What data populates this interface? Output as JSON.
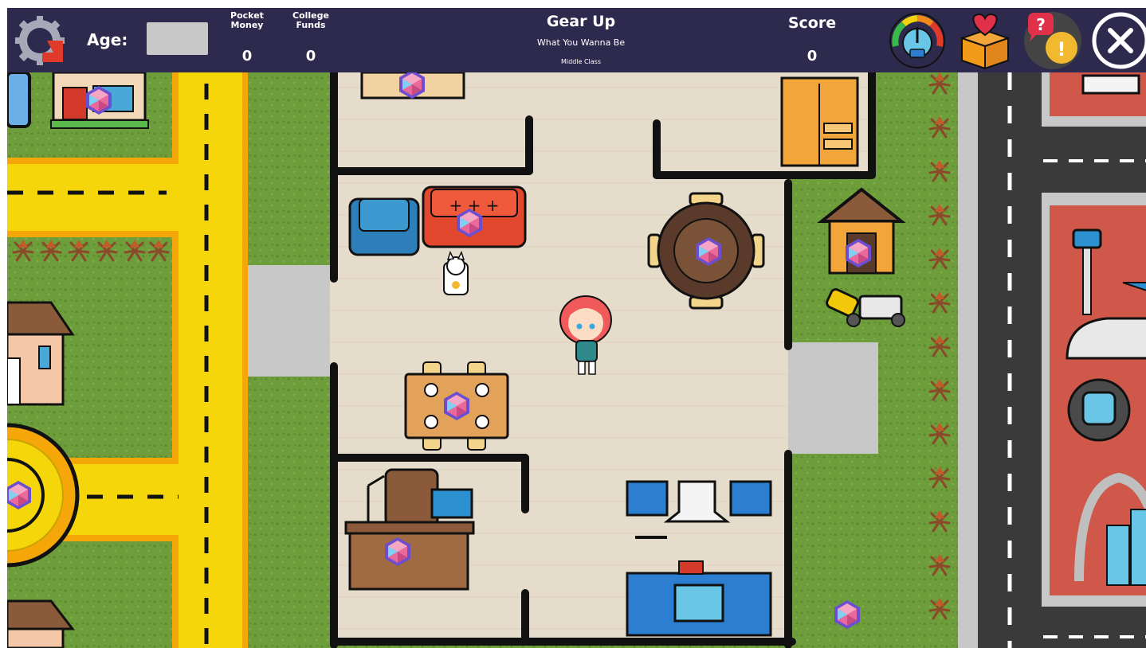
{
  "hud": {
    "age_label": "Age:",
    "age_value": "",
    "pocket_money_label": "Pocket Money",
    "pocket_money_value": "0",
    "college_funds_label": "College Funds",
    "college_funds_value": "0",
    "title": "Gear Up",
    "subtitle": "What You Wanna Be",
    "social_class": "Middle Class",
    "score_label": "Score",
    "score_value": "0"
  },
  "icons": {
    "logo": "gear-logo-icon",
    "meter": "speedometer-icon",
    "gift": "heart-gift-box-icon",
    "help": "question-exclamation-icon",
    "close": "close-icon"
  },
  "colors": {
    "hud_bg": "#2e2a4e",
    "grass": "#6a9a3a",
    "house_floor": "#e6dccb",
    "yellow_road": "#f5d60a",
    "asphalt": "#3a3a3a",
    "red_zone": "#d0584a",
    "gem": "#e8699a"
  }
}
